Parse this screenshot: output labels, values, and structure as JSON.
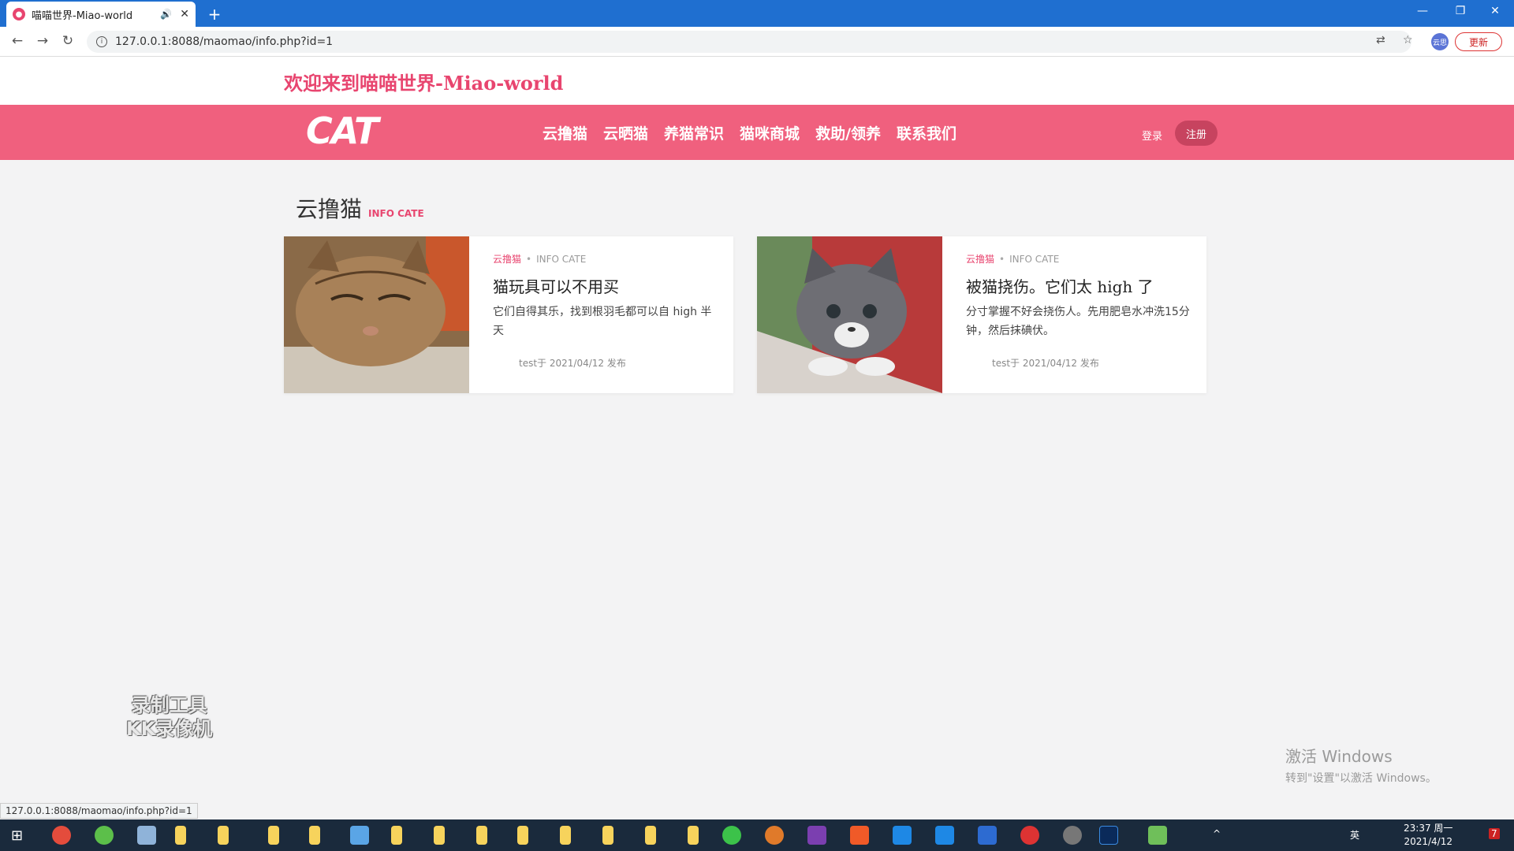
{
  "browser": {
    "tab_title": "喵喵世界-Miao-world",
    "url": "127.0.0.1:8088/maomao/info.php?id=1",
    "update_label": "更新",
    "profile_label": "云思"
  },
  "page": {
    "welcome": "欢迎来到喵喵世界-Miao-world",
    "logo": "CAT",
    "nav": [
      "云撸猫",
      "云晒猫",
      "养猫常识",
      "猫咪商城",
      "救助/领养",
      "联系我们"
    ],
    "login": "登录",
    "register": "注册",
    "section_title": "云撸猫",
    "section_subtitle": "INFO CATE"
  },
  "cards": [
    {
      "category": "云撸猫",
      "info": "INFO CATE",
      "title": "猫玩具可以不用买",
      "excerpt": "它们自得其乐，找到根羽毛都可以自 high 半天",
      "author": "test于 2021/04/12 发布"
    },
    {
      "category": "云撸猫",
      "info": "INFO CATE",
      "title": "被猫挠伤。它们太 high 了",
      "excerpt": "分寸掌握不好会挠伤人。先用肥皂水冲洗15分钟，然后抹碘伏。",
      "author": "test于 2021/04/12 发布"
    }
  ],
  "overlay": {
    "recorder_line1": "录制工具",
    "recorder_line2": "KK录像机",
    "activate_line1": "激活 Windows",
    "activate_line2": "转到\"设置\"以激活 Windows。"
  },
  "statusbar": "127.0.0.1:8088/maomao/info.php?id=1",
  "taskbar": {
    "time": "23:37 周一",
    "date": "2021/4/12",
    "lang": "英",
    "notif_count": "7"
  },
  "colors": {
    "accent": "#e8456f",
    "navbar": "#f0607e",
    "titlebar": "#1f6fd0"
  }
}
